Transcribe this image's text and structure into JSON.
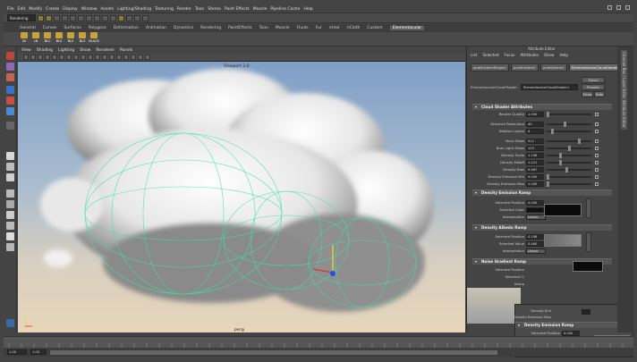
{
  "menubar": {
    "items": [
      "File",
      "Edit",
      "Modify",
      "Create",
      "Display",
      "Window",
      "Assets",
      "Lighting/Shading",
      "Texturing",
      "Render",
      "Toon",
      "Stereo",
      "Paint Effects",
      "Muscle",
      "Pipeline Cache",
      "Help"
    ]
  },
  "toolbar": {
    "mode": "Rendering"
  },
  "shelf": {
    "tabs": [
      "General",
      "Curves",
      "Surfaces",
      "Polygons",
      "Deformation",
      "Animation",
      "Dynamics",
      "Rendering",
      "PaintEffects",
      "Toon",
      "Muscle",
      "Fluids",
      "Fur",
      "nHair",
      "nCloth",
      "Custom",
      "Elementacular"
    ],
    "active_tab": "Elementacular",
    "icons": [
      "SS",
      "LN",
      "BLC",
      "BLS",
      "BLS",
      "BL3",
      "BLACK"
    ]
  },
  "viewport": {
    "menu": [
      "View",
      "Shading",
      "Lighting",
      "Show",
      "Renderer",
      "Panels"
    ],
    "label": "Viewport 2.0",
    "camera": "persp"
  },
  "attribute_editor": {
    "title": "Attribute Editor",
    "menu": [
      "List",
      "Selected",
      "Focus",
      "Attributes",
      "Show",
      "Help"
    ],
    "node_tabs": [
      "poleSurfaceShape1",
      "poleSurface1",
      "poleSphere1",
      "ElementacularCloudShader1"
    ],
    "node_label": "ElementacularCloudShader:",
    "node_value": "ElementacularCloudShader1",
    "focus_label": "Focus",
    "presets_label": "Presets",
    "show_label": "Show",
    "hide_label": "Hide",
    "sections": {
      "cloud": "Cloud Shader Attributes",
      "emission": "Density Emission Ramp",
      "albedo": "Density Albedo Ramp",
      "noise": "Noise Gradient Ramp"
    },
    "cloud_rows": [
      {
        "label": "Render Quality",
        "value": "1.000",
        "slider": 0.0
      },
      {
        "label": "Distance Resolution",
        "value": "40",
        "slider": 0.4
      },
      {
        "label": "Ditalion Layers",
        "value": "4",
        "slider": 0.1
      },
      {
        "label": "Num Steps",
        "value": "512",
        "slider": 0.75
      },
      {
        "label": "Num Light Steps",
        "value": "125",
        "slider": 0.5
      },
      {
        "label": "Density Scale",
        "value": "1.198",
        "slider": 0.3
      },
      {
        "label": "Density Falloff",
        "value": "1.221",
        "slider": 0.3
      },
      {
        "label": "Density Bias",
        "value": "0.467",
        "slider": 0.45
      },
      {
        "label": "Density Emission Min",
        "value": "0.000",
        "slider": 0.0
      },
      {
        "label": "Density Emission Max",
        "value": "1.000",
        "slider": 0.0
      }
    ],
    "emission_rows": {
      "position_label": "Selected Position",
      "position_value": "0.000",
      "color_label": "Selected Color",
      "interp_label": "Interpolation",
      "interp_value": "Linear"
    },
    "albedo_rows": {
      "position_label": "Selected Position",
      "position_value": "0.198",
      "value_label": "Selected Value",
      "value_value": "0.460",
      "interp_label": "Interpolation",
      "interp_value": "Linear"
    },
    "noise_rows": {
      "position_label": "Selected Position",
      "color_label": "Selected Cl",
      "interp_label": "Interp"
    }
  },
  "floating": {
    "rows": [
      "Density Emi",
      "Density Emission Max"
    ],
    "section": "Density Emission Ramp",
    "position_label": "Selected Position",
    "position_value": "0.000",
    "color_label": "Selected Color",
    "interp_label": "Interpolation",
    "interp_value": "Linear",
    "side_labels": [
      "Spin Cl",
      "Opacus"
    ]
  },
  "side_tabs": [
    "Channel Box / Layer Editor",
    "Attribute Editor",
    "Tool Settings"
  ],
  "timeline": {
    "start": "1.00",
    "end": "1.00"
  },
  "colors": {
    "accent": "#c9a23a",
    "wire": "#3fe0a8",
    "sky_top": "#7f9fc6",
    "sky_bottom": "#e7d5ba"
  }
}
